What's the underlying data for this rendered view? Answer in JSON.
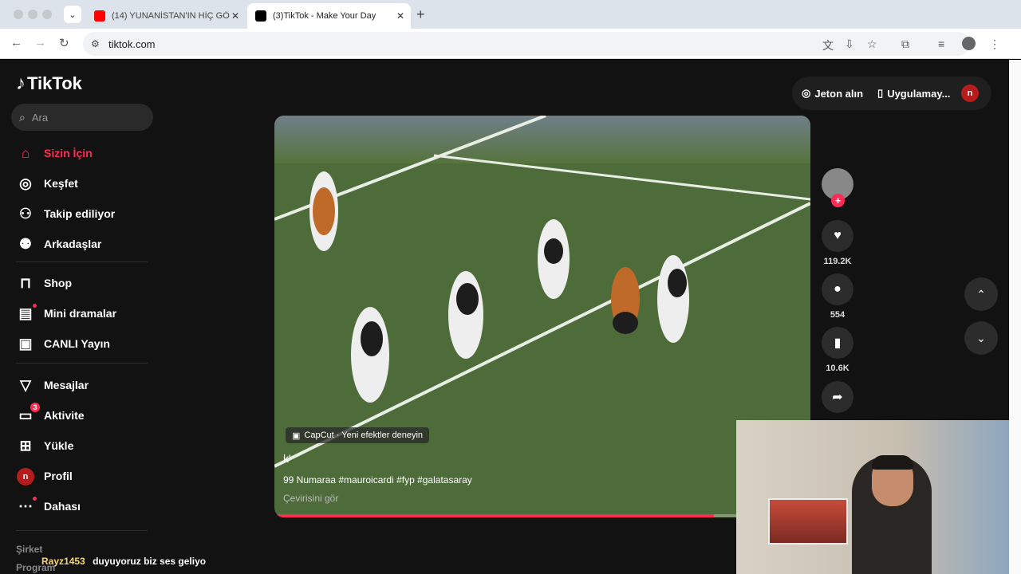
{
  "browser": {
    "tabs": [
      {
        "title": "(14) YUNANİSTAN'IN HİÇ GÖ",
        "active": false,
        "favicon_color": "#ff0000"
      },
      {
        "title": "(3)TikTok - Make Your Day",
        "active": true,
        "favicon_color": "#000000"
      }
    ],
    "url": "tiktok.com"
  },
  "tiktok": {
    "logo": "TikTok",
    "search_placeholder": "Ara",
    "nav": [
      {
        "label": "Sizin İçin",
        "icon": "home-icon",
        "active": true
      },
      {
        "label": "Keşfet",
        "icon": "compass-icon"
      },
      {
        "label": "Takip ediliyor",
        "icon": "following-icon"
      },
      {
        "label": "Arkadaşlar",
        "icon": "friends-icon"
      },
      {
        "label": "Shop",
        "icon": "shop-icon"
      },
      {
        "label": "Mini dramalar",
        "icon": "mini-drama-icon"
      },
      {
        "label": "CANLI Yayın",
        "icon": "live-icon"
      },
      {
        "label": "Mesajlar",
        "icon": "messages-icon"
      },
      {
        "label": "Aktivite",
        "icon": "activity-icon",
        "badge": "3"
      },
      {
        "label": "Yükle",
        "icon": "upload-icon"
      },
      {
        "label": "Profil",
        "icon": "profile-avatar-icon"
      },
      {
        "label": "Dahası",
        "icon": "more-icon"
      }
    ],
    "footer": [
      "Şirket",
      "Program"
    ],
    "top_actions": {
      "coins": "Jeton alın",
      "app": "Uygulamay...",
      "avatar_letter": "n"
    },
    "video": {
      "capcut": "CapCut · Yeni efektler deneyin",
      "title": "k'",
      "description": "99 Numaraa #mauroicardi #fyp #galatasaray",
      "translate": "Çevirisini gör",
      "progress": 0.82
    },
    "actions": {
      "likes": "119.2K",
      "comments": "554",
      "saves": "10.6K"
    }
  },
  "chat": {
    "user": "Rayz1453",
    "message": "duyuyoruz biz ses geliyo"
  },
  "colors": {
    "accent": "#fe2c55"
  }
}
